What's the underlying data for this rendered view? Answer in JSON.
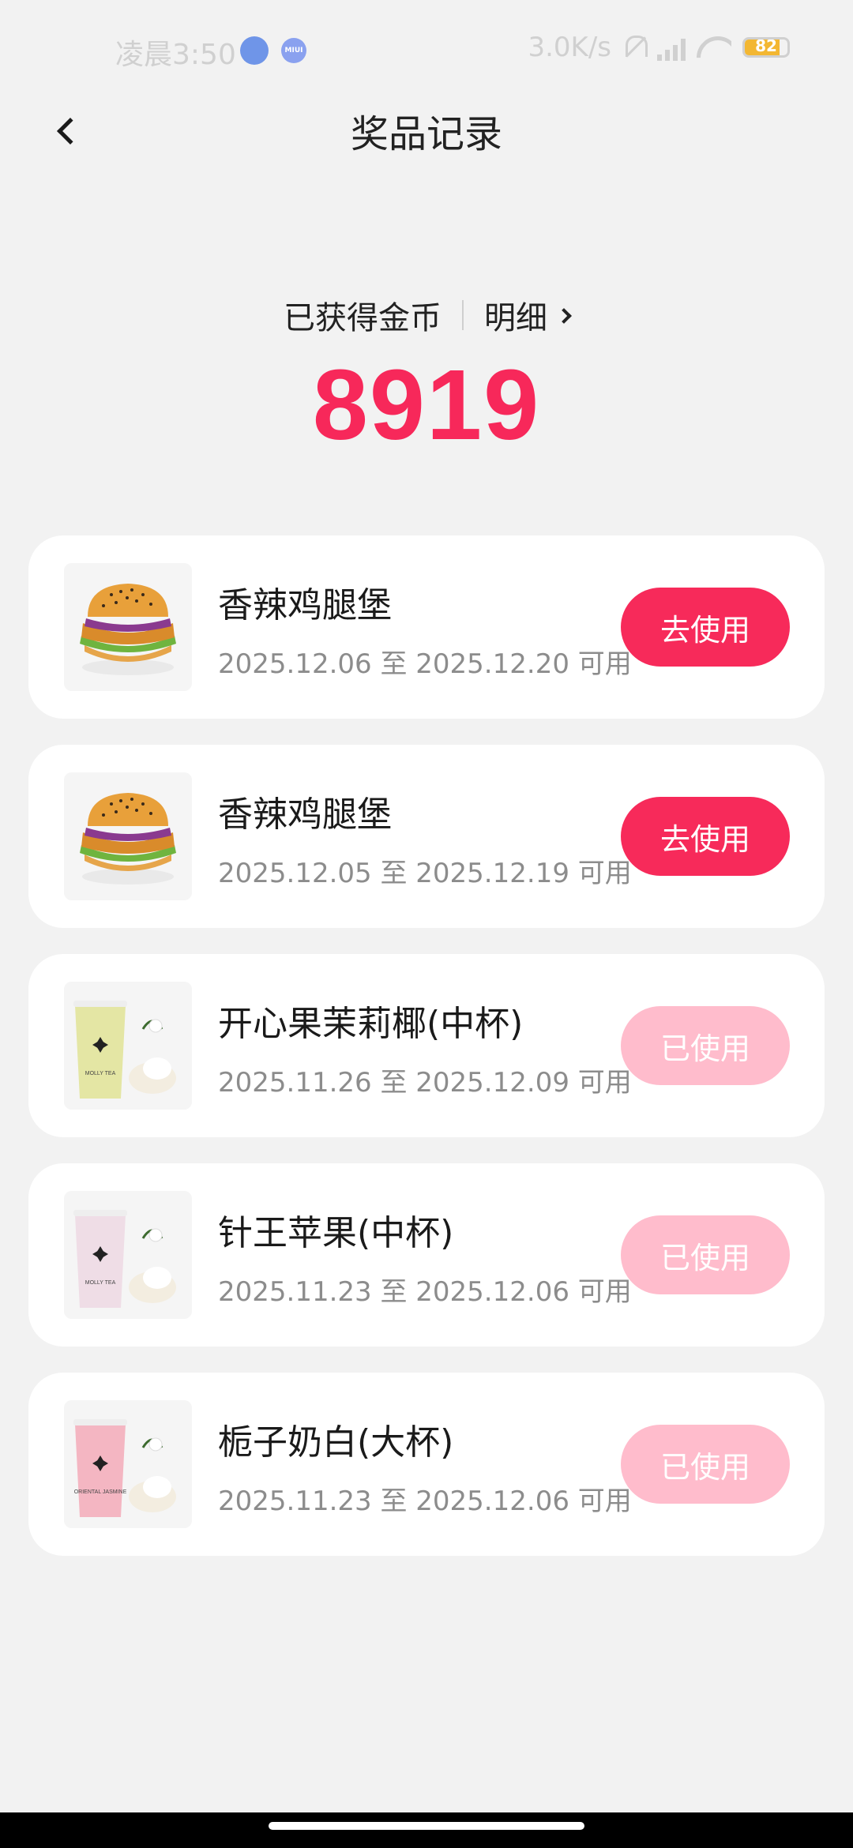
{
  "status_bar": {
    "time": "凌晨3:50",
    "miui_badge": "MIUI",
    "network_speed": "3.0K/s",
    "battery": "82",
    "battery_level": 0.82,
    "battery_color": "#f3b732"
  },
  "header": {
    "title": "奖品记录",
    "back_icon": "chevron-left-icon"
  },
  "coins": {
    "label": "已获得金币",
    "detail_label": "明细",
    "value": "8919",
    "value_color": "#f7285a"
  },
  "prizes": [
    {
      "name": "香辣鸡腿堡",
      "dates": "2025.12.06 至 2025.12.20 可用",
      "button": "去使用",
      "status": "active",
      "image": "burger"
    },
    {
      "name": "香辣鸡腿堡",
      "dates": "2025.12.05 至 2025.12.19 可用",
      "button": "去使用",
      "status": "active",
      "image": "burger"
    },
    {
      "name": "开心果茉莉椰(中杯)",
      "dates": "2025.11.26 至 2025.12.09 可用",
      "button": "已使用",
      "status": "used",
      "image": "pistachio-drink",
      "cup_text": "MOLLY TEA"
    },
    {
      "name": "针王苹果(中杯)",
      "dates": "2025.11.23 至 2025.12.06 可用",
      "button": "已使用",
      "status": "used",
      "image": "apple-drink",
      "cup_text": "MOLLY TEA"
    },
    {
      "name": "栀子奶白(大杯)",
      "dates": "2025.11.23 至 2025.12.06 可用",
      "button": "已使用",
      "status": "used",
      "image": "gardenia-drink",
      "cup_text": "ORIENTAL JASMINE"
    }
  ],
  "colors": {
    "accent": "#f72a5a",
    "used_button": "#ffbccc",
    "background": "#f2f2f2"
  }
}
